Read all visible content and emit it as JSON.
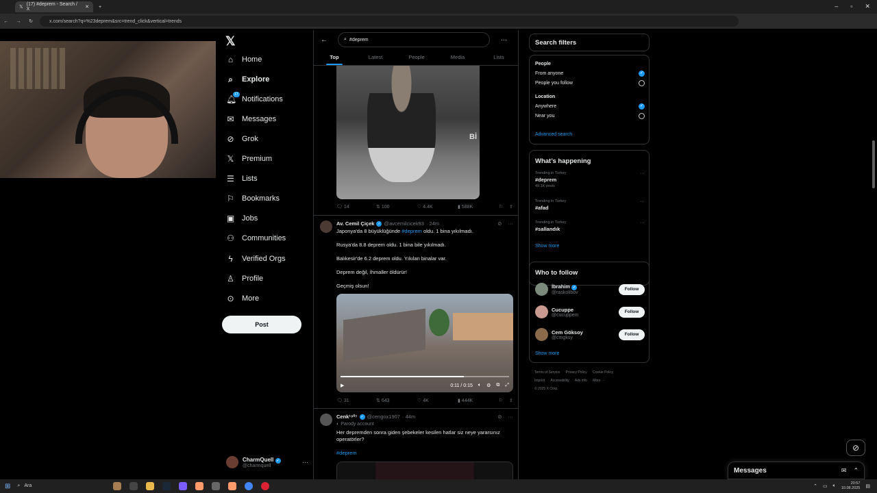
{
  "browser": {
    "tab_title": "(17) #deprem - Search / X",
    "url": "x.com/search?q=%23deprem&src=trend_click&vertical=trends"
  },
  "nav": {
    "items": [
      {
        "label": "Home",
        "icon": "home-icon"
      },
      {
        "label": "Explore",
        "icon": "search-icon"
      },
      {
        "label": "Notifications",
        "icon": "bell-icon",
        "badge": "17"
      },
      {
        "label": "Messages",
        "icon": "mail-icon"
      },
      {
        "label": "Grok",
        "icon": "grok-icon"
      },
      {
        "label": "Premium",
        "icon": "x-icon"
      },
      {
        "label": "Lists",
        "icon": "list-icon"
      },
      {
        "label": "Bookmarks",
        "icon": "bookmark-icon"
      },
      {
        "label": "Jobs",
        "icon": "briefcase-icon"
      },
      {
        "label": "Communities",
        "icon": "people-icon"
      },
      {
        "label": "Verified Orgs",
        "icon": "lightning-icon"
      },
      {
        "label": "Profile",
        "icon": "person-icon"
      },
      {
        "label": "More",
        "icon": "more-circle-icon"
      }
    ],
    "post_label": "Post",
    "account": {
      "name": "CharmQuell",
      "handle": "@charmquell"
    }
  },
  "search": {
    "query": "#deprem",
    "tabs": [
      "Top",
      "Latest",
      "People",
      "Media",
      "Lists"
    ]
  },
  "tweet1": {
    "replies": "14",
    "retweets": "100",
    "likes": "4.4K",
    "views": "588K",
    "image_text": "Bİ"
  },
  "tweet2": {
    "name": "Av. Cemil Çiçek",
    "handle": "@avcemilcicek93",
    "time": "· 24m",
    "line1_pre": "Japonya'da 8 büyüklüğünde ",
    "line1_tag": "#deprem",
    "line1_post": " oldu. 1 bina yıkılmadı.",
    "line2": "Rusya'da 8.8 deprem oldu. 1 bina bile yıkılmadı.",
    "line3": "Balıkesir'de 6.2 deprem oldu. Yıkılan binalar var.",
    "line4": "Deprem değil, İhmaller öldürür!",
    "line5": "Geçmiş olsun!",
    "video_time": "0:11 / 0:15",
    "replies": "31",
    "retweets": "643",
    "likes": "4K",
    "views": "444K"
  },
  "tweet3": {
    "name": "Cenk¹⁹⁰⁷",
    "handle": "@cengox1907",
    "time": "· 44m",
    "parody": "Parody account",
    "text": "Her depremden sonra giden şebekeler kesilen hatlar siz neye yararsınız operatörler?",
    "tag": "#deprem"
  },
  "filters": {
    "title": "Search filters",
    "people_label": "People",
    "from_anyone": "From anyone",
    "people_you_follow": "People you follow",
    "location_label": "Location",
    "anywhere": "Anywhere",
    "near_you": "Near you",
    "advanced": "Advanced search"
  },
  "happening": {
    "title": "What’s happening",
    "trends": [
      {
        "context": "Trending in Turkey",
        "tag": "#deprem",
        "count": "49.1K posts"
      },
      {
        "context": "Trending in Turkey",
        "tag": "#afad",
        "count": ""
      },
      {
        "context": "Trending in Turkey",
        "tag": "#sallandık",
        "count": ""
      }
    ],
    "show_more": "Show more"
  },
  "who_to_follow": {
    "title": "Who to follow",
    "users": [
      {
        "name": "İbrahim",
        "handle": "@raskolibov",
        "verified": true
      },
      {
        "name": "Cucuppe",
        "handle": "@cucuppem",
        "verified": false
      },
      {
        "name": "Cem Göksoy",
        "handle": "@cmgksy",
        "verified": false
      }
    ],
    "follow_label": "Follow",
    "show_more": "Show more"
  },
  "footer": {
    "links": [
      "Terms of Service",
      "Privacy Policy",
      "Cookie Policy",
      "Imprint",
      "Accessibility",
      "Ads info",
      "More ···"
    ],
    "copyright": "© 2025 X Corp."
  },
  "messages_drawer": {
    "title": "Messages"
  },
  "taskbar": {
    "search": "Ara",
    "time": "20:57",
    "date": "10.08.2025"
  }
}
